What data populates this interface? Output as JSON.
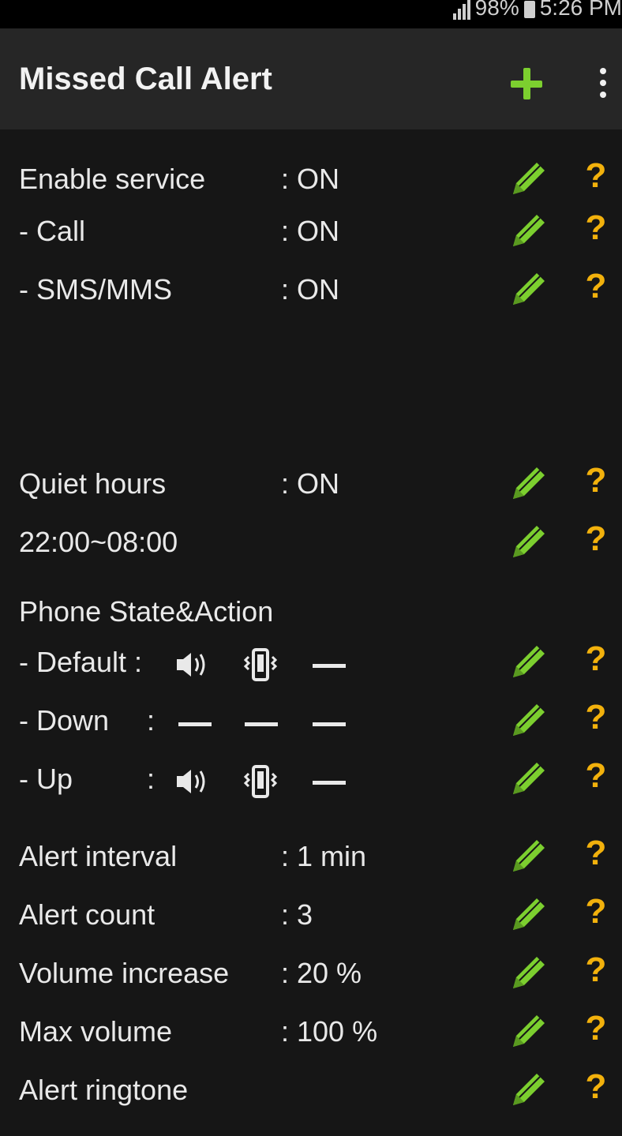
{
  "status_bar": {
    "battery": "98%",
    "time": "5:26 PM"
  },
  "app_bar": {
    "title": "Missed Call Alert",
    "add_icon": "plus-icon",
    "menu_icon": "more-vertical-icon"
  },
  "rows": {
    "enable_service": {
      "label": "Enable service",
      "value": ": ON"
    },
    "call": {
      "label": "- Call",
      "value": ": ON"
    },
    "sms": {
      "label": "- SMS/MMS",
      "value": ": ON"
    },
    "quiet_hours": {
      "label": "Quiet hours",
      "value": ": ON"
    },
    "quiet_range": {
      "label": "22:00~08:00"
    },
    "phone_state": {
      "label": "Phone State&Action"
    },
    "default": {
      "label": "- Default :",
      "icons": [
        "speaker-icon",
        "vibrate-icon",
        "dash-icon"
      ]
    },
    "down": {
      "label": "- Down",
      "sep": ":",
      "icons": [
        "dash-icon",
        "dash-icon",
        "dash-icon"
      ]
    },
    "up": {
      "label": "- Up",
      "sep": ":",
      "icons": [
        "speaker-icon",
        "vibrate-icon",
        "dash-icon"
      ]
    },
    "alert_interval": {
      "label": "Alert interval",
      "value": ": 1 min"
    },
    "alert_count": {
      "label": "Alert count",
      "value": ": 3"
    },
    "volume_increase": {
      "label": "Volume increase",
      "value": ": 20 %"
    },
    "max_volume": {
      "label": "Max volume",
      "value": ": 100 %"
    },
    "alert_ringtone": {
      "label": "Alert ringtone"
    }
  },
  "edit_icon": "pencil-icon",
  "help_label": "?",
  "colors": {
    "accent_green": "#7ccf2f",
    "help_yellow": "#f2b10c",
    "background": "#161616",
    "app_bar": "#262626"
  }
}
